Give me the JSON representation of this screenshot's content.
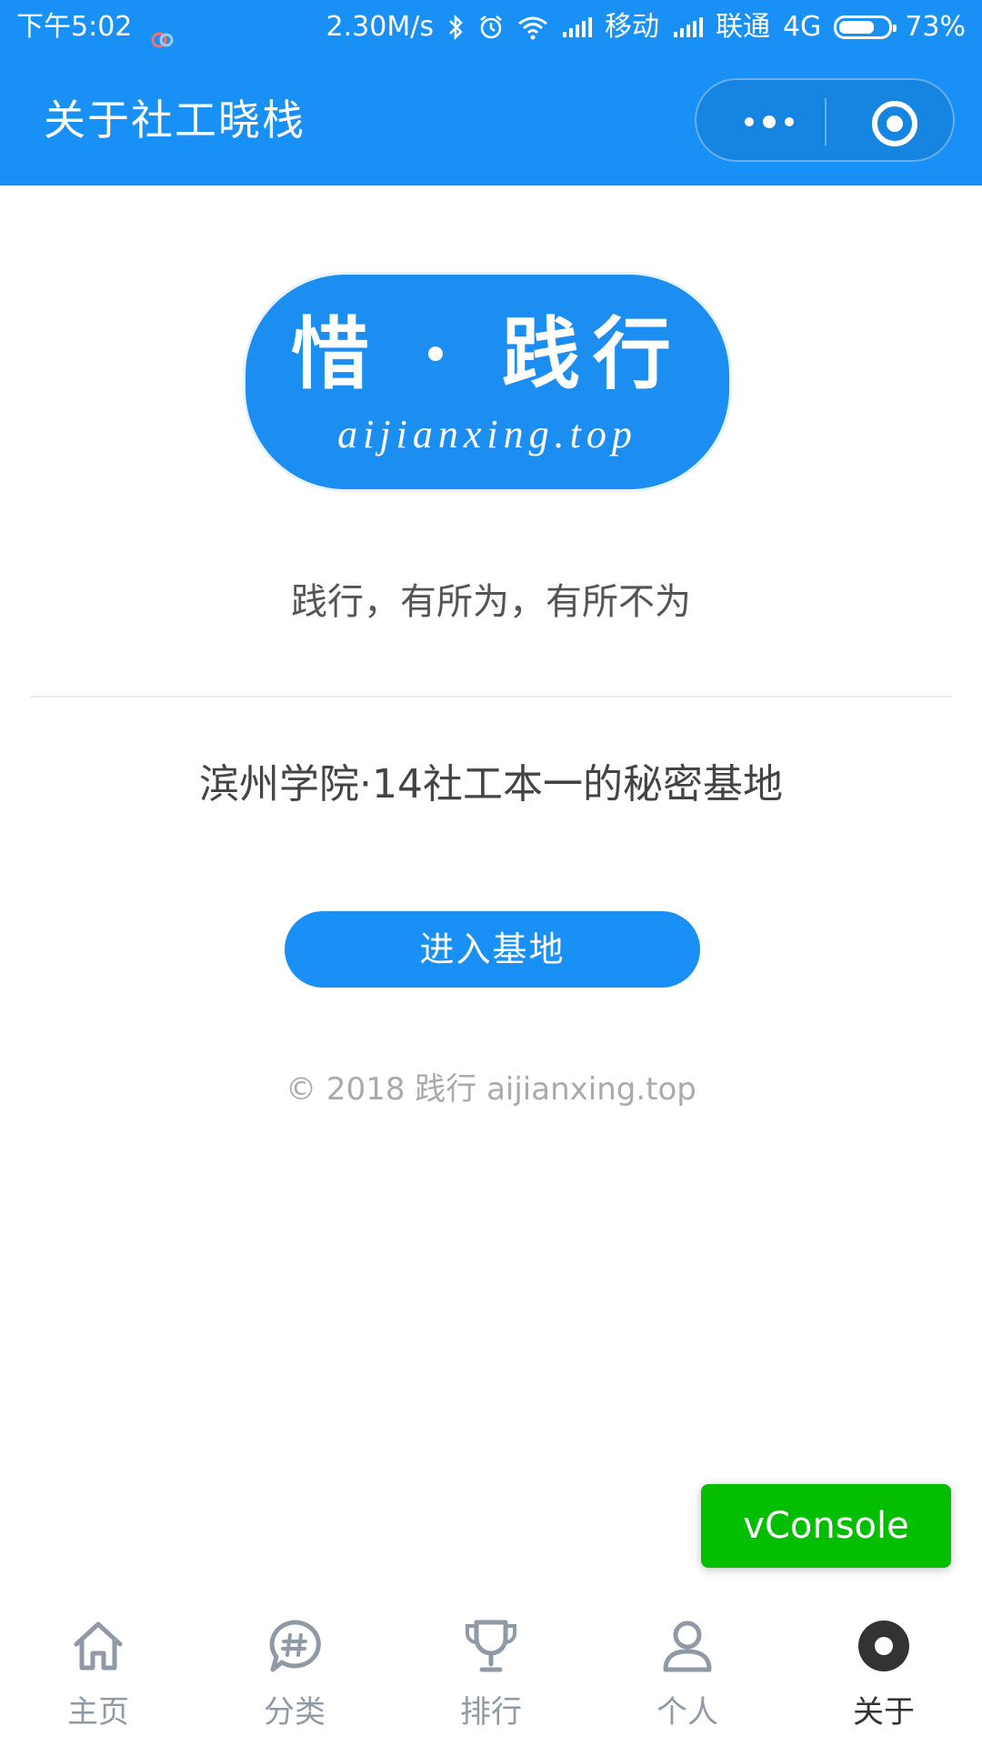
{
  "status_bar": {
    "time": "下午5:02",
    "speed": "2.30M/s",
    "carrier1": "移动",
    "carrier2": "联通",
    "network": "4G",
    "battery": "73%",
    "battery_level": 0.73
  },
  "header": {
    "title": "关于社工晓栈",
    "menu_icon": "more-dots-icon",
    "close_icon": "target-circle-icon"
  },
  "logo": {
    "main_text": "惜 · 践行",
    "sub_text": "aijianxing.top"
  },
  "content": {
    "slogan": "践行，有所为，有所不为",
    "subtitle": "滨州学院·14社工本一的秘密基地",
    "enter_button": "进入基地",
    "footer": "© 2018 践行 aijianxing.top"
  },
  "vconsole": {
    "label": "vConsole"
  },
  "tabbar": {
    "items": [
      {
        "label": "主页",
        "icon": "home-icon"
      },
      {
        "label": "分类",
        "icon": "hashtag-bubble-icon"
      },
      {
        "label": "排行",
        "icon": "trophy-icon"
      },
      {
        "label": "个人",
        "icon": "user-icon"
      },
      {
        "label": "关于",
        "icon": "about-dot-icon"
      }
    ],
    "active_index": 4
  },
  "colors": {
    "primary": "#1890f5",
    "vconsole_green": "#04be02",
    "tab_inactive": "#8f9aa6",
    "tab_active": "#333333"
  }
}
